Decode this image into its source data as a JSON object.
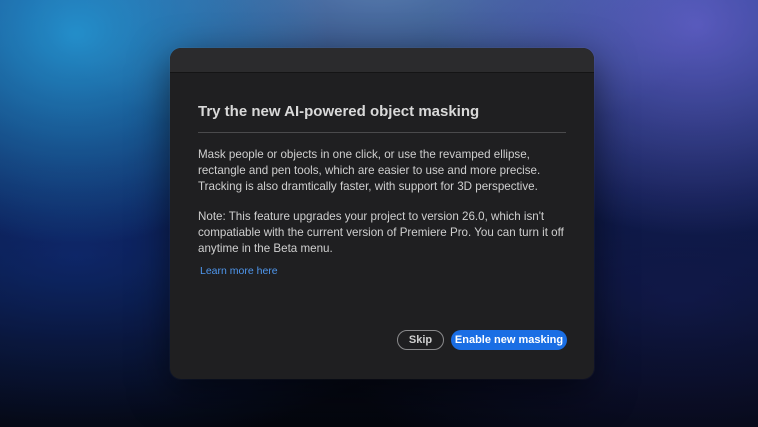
{
  "dialog": {
    "title": "Try the new AI-powered object masking",
    "paragraph1": "Mask people or objects in one click, or use the revamped ellipse, rectangle and pen tools, which are easier to use and more precise. Tracking is also dramtically faster, with support for 3D perspective.",
    "paragraph2": "Note: This feature upgrades your project to version 26.0, which isn't compatiable with the current version of Premiere Pro. You can turn it off anytime in the Beta menu.",
    "learn_more_label": "Learn more here",
    "skip_label": "Skip",
    "primary_label": "Enable new masking"
  },
  "colors": {
    "dialog_background": "#1f1f21",
    "title_bar": "#2b2b2d",
    "link": "#4f97ee",
    "primary_button": "#1a6ee4"
  }
}
